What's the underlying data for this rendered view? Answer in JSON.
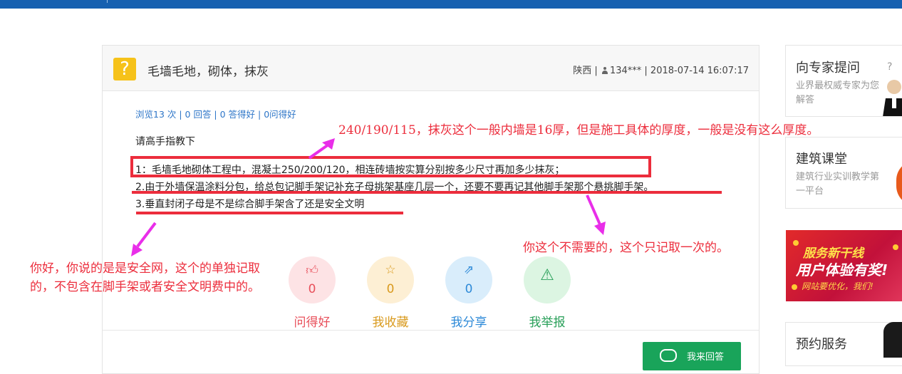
{
  "question": {
    "title": "毛墙毛地，砌体，抹灰",
    "icon": "question-mark-icon",
    "meta_region": "陕西",
    "meta_user": "134***",
    "meta_time": "2018-07-14 16:07:17",
    "stats": "浏览13 次 | 0 回答 | 0 答得好 | 0问得好",
    "body": [
      "请高手指教下",
      "1：毛墙毛地砌体工程中，混凝土250/200/120，相连砖墙按实算分别按多少尺寸再加多少抹灰；",
      "2.由于外墙保温涂料分包，给总包记脚手架记补充子母挑架基座几层一个，还要不要再记其他脚手架那个悬挑脚手架。",
      "3.垂直封闭子母是不是综合脚手架含了还是安全文明"
    ]
  },
  "actions": [
    {
      "label": "问得好",
      "count": "0",
      "icon": "thumbs-up-icon",
      "color": "#e8505b",
      "bg": "#fde3e5"
    },
    {
      "label": "我收藏",
      "count": "0",
      "icon": "star-icon",
      "color": "#d99a1e",
      "bg": "#fdefd4"
    },
    {
      "label": "我分享",
      "count": "0",
      "icon": "share-icon",
      "color": "#2e8ad8",
      "bg": "#d9edfb"
    },
    {
      "label": "我举报",
      "count": "",
      "icon": "warning-icon",
      "color": "#2aa05a",
      "bg": "#dcf5e2"
    }
  ],
  "answer_button": "我来回答",
  "sidebar": {
    "expert": {
      "title": "向专家提问",
      "subtitle": "业界最权威专家为您解答"
    },
    "course": {
      "title": "建筑课堂",
      "subtitle": "建筑行业实训教学第一平台"
    },
    "banner": {
      "line1": "服务新干线",
      "line2": "用户体验有奖!",
      "line3": "网站要优化，我们!"
    },
    "booking": {
      "title": "预约服务"
    }
  },
  "annotations": {
    "top": "240/190/115，抹灰这个一般内墙是16厚，但是施工具体的厚度，一般是没有这么厚度。",
    "middle": "你这个不需要的，这个只记取一次的。",
    "left": "你好，你说的是是安全网，这个的单独记取的，不包含在脚手架或者安全文明费中的。"
  },
  "colors": {
    "accent_blue": "#1660b0",
    "annotation_red": "#ec2d3c",
    "annotation_arrow": "#e92ee9",
    "answer_green": "#19a45a"
  }
}
